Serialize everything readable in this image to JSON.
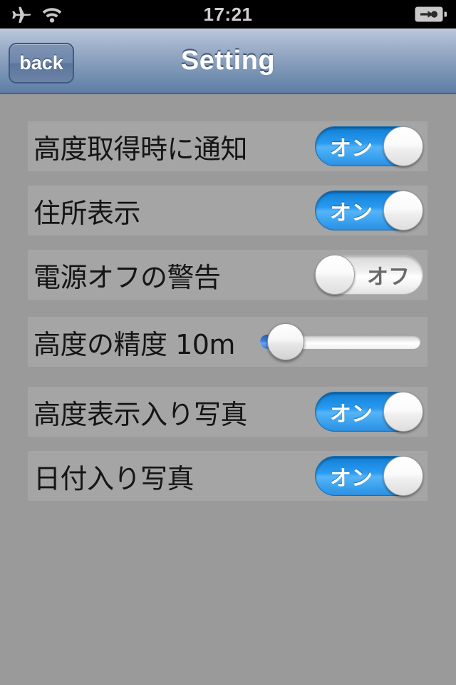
{
  "status_bar": {
    "airplane_icon": "airplane-icon",
    "wifi_icon": "wifi-icon",
    "time": "17:21",
    "battery_icon": "battery-charging-icon"
  },
  "nav_bar": {
    "back_label": "back",
    "title": "Setting"
  },
  "colors": {
    "accent_blue": "#2a9bf0",
    "nav_top": "#bcc9dd",
    "nav_bottom": "#5f7da4",
    "page_background": "#9a9a9a",
    "row_background": "#a5a5a5",
    "slider_fill": "#3f7ed8"
  },
  "settings": {
    "rows": [
      {
        "label": "高度取得時に通知",
        "control": "toggle",
        "state": "on",
        "state_label": "オン",
        "name": "notify-on-altitude-acquired"
      },
      {
        "label": "住所表示",
        "control": "toggle",
        "state": "on",
        "state_label": "オン",
        "name": "show-address"
      },
      {
        "label": "電源オフの警告",
        "control": "toggle",
        "state": "off",
        "state_label": "オフ",
        "name": "power-off-warning"
      },
      {
        "label": "高度の精度 10m",
        "control": "slider",
        "value_label": "10m",
        "percent": 6,
        "name": "altitude-precision"
      },
      {
        "label": "高度表示入り写真",
        "control": "toggle",
        "state": "on",
        "state_label": "オン",
        "name": "photo-with-altitude-stamp"
      },
      {
        "label": "日付入り写真",
        "control": "toggle",
        "state": "on",
        "state_label": "オン",
        "name": "photo-with-date-stamp"
      }
    ]
  }
}
